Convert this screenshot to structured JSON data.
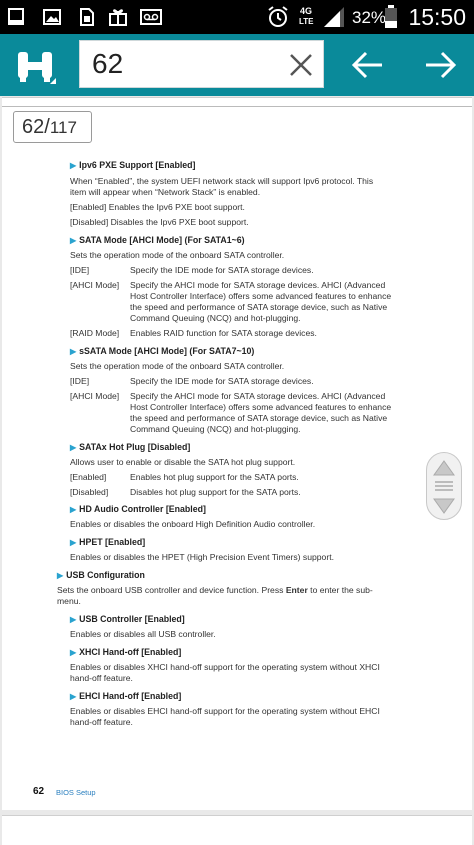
{
  "statusbar": {
    "battery_percent": "32%",
    "time": "15:50",
    "network_label": "4G LTE"
  },
  "toolbar": {
    "search_value": "62",
    "accent_color": "#0a8a9a"
  },
  "pager": {
    "current": "62/",
    "total": "117"
  },
  "doc": {
    "ipv6_heading": "Ipv6 PXE Support [Enabled]",
    "ipv6_desc_1": "When “Enabled”, the system UEFI network stack will support Ipv6 protocol. This",
    "ipv6_desc_2": "item will appear when “Network Stack” is enabled.",
    "ipv6_enabled": "[Enabled] Enables the Ipv6 PXE boot support.",
    "ipv6_disabled": "[Disabled] Disables the Ipv6 PXE boot support.",
    "sata_heading": "SATA Mode [AHCI Mode] (For SATA1~6)",
    "sata_desc": "Sets the operation mode of the onboard SATA controller.",
    "sata_ide_k": "[IDE]",
    "sata_ide_v": "Specify the IDE mode for SATA storage devices.",
    "sata_ahci_k": "[AHCI Mode]",
    "sata_ahci_v1": "Specify the AHCI mode for SATA storage devices. AHCI (Advanced",
    "sata_ahci_v2": "Host Controller Interface) offers some advanced features to enhance",
    "sata_ahci_v3": "the speed and performance of SATA storage device, such as Native",
    "sata_ahci_v4": "Command Queuing (NCQ) and hot-plugging.",
    "sata_raid_k": "[RAID Mode]",
    "sata_raid_v": "Enables RAID function for SATA storage devices.",
    "ssata_heading": "sSATA Mode [AHCI Mode] (For SATA7~10)",
    "ssata_desc": "Sets the operation mode of the onboard SATA controller.",
    "ssata_ide_k": "[IDE]",
    "ssata_ide_v": "Specify the IDE mode for SATA storage devices.",
    "ssata_ahci_k": "[AHCI Mode]",
    "ssata_ahci_v1": "Specify the AHCI mode for SATA storage devices. AHCI (Advanced",
    "ssata_ahci_v2": "Host Controller Interface) offers some advanced features to enhance",
    "ssata_ahci_v3": "the speed and performance of SATA storage device, such as Native",
    "ssata_ahci_v4": "Command Queuing (NCQ) and hot-plugging.",
    "hotplug_heading": "SATAx Hot Plug [Disabled]",
    "hotplug_desc": "Allows user to enable or disable the SATA hot plug support.",
    "hotplug_en_k": "[Enabled]",
    "hotplug_en_v": "Enables hot plug support for the SATA ports.",
    "hotplug_dis_k": "[Disabled]",
    "hotplug_dis_v": "Disables hot plug support for the SATA ports.",
    "hda_heading": "HD Audio Controller [Enabled]",
    "hda_desc": "Enables or disables the onboard High Definition Audio controller.",
    "hpet_heading": "HPET [Enabled]",
    "hpet_desc": "Enables or disables the HPET (High Precision Event Timers) support.",
    "usbcfg_heading": "USB Configuration",
    "usbcfg_desc_a": "Sets the onboard USB controller and device function. Press ",
    "usbcfg_desc_key": "Enter",
    "usbcfg_desc_b": " to enter the sub-",
    "usbcfg_desc_2": "menu.",
    "usbctl_heading": "USB Controller [Enabled]",
    "usbctl_desc": "Enables or disables all USB controller.",
    "xhci_heading": "XHCI Hand-off [Enabled]",
    "xhci_desc_1": "Enables or disables XHCI hand-off support for the operating system without XHCI",
    "xhci_desc_2": "hand-off feature.",
    "ehci_heading": "EHCI Hand-off [Enabled]",
    "ehci_desc_1": "Enables or disables EHCI hand-off support for the operating system without EHCI",
    "ehci_desc_2": "hand-off feature.",
    "footer_page": "62",
    "footer_title": "BIOS Setup"
  }
}
